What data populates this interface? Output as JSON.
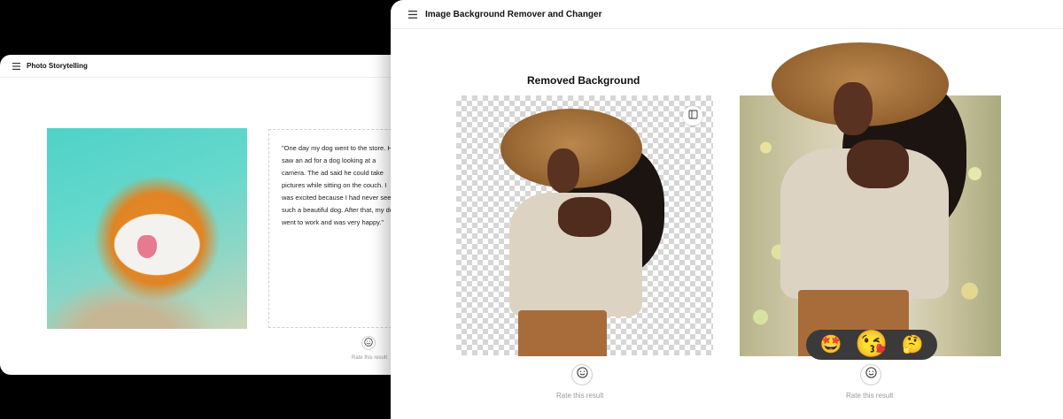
{
  "back_window": {
    "title": "Photo Storytelling",
    "story_text": "\"One day my dog went to the store. He saw an ad for a dog looking at a camera. The ad said he could take pictures while sitting on the couch. I was excited because I had never seen such a beautiful dog. After that, my dog went to work and was very happy.\"",
    "rate_label": "Rate this result"
  },
  "front_window": {
    "title": "Image Background Remover and Changer",
    "section_heading": "Removed Background",
    "rate_label_left": "Rate this result",
    "rate_label_right": "Rate this result"
  },
  "emoji_bar": {
    "emojis": [
      "🤩",
      "😘",
      "🤔"
    ]
  },
  "icons": {
    "menu": "menu-icon",
    "smiley": "smiley-icon",
    "panel": "panel-toggle-icon"
  }
}
